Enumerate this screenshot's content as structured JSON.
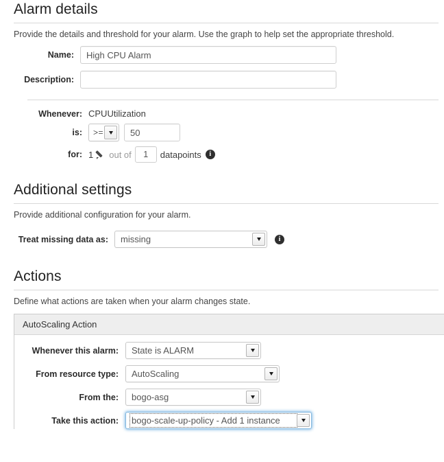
{
  "alarm_details": {
    "title": "Alarm details",
    "description": "Provide the details and threshold for your alarm. Use the graph to help set the appropriate threshold.",
    "name_label": "Name:",
    "name_value": "High CPU Alarm",
    "description_label": "Description:",
    "description_value": "",
    "whenever_label": "Whenever:",
    "metric_name": "CPUUtilization",
    "is_label": "is:",
    "operator_value": ">=",
    "threshold_value": "50",
    "for_label": "for:",
    "for_count": "1",
    "out_of_text": "out of",
    "datapoints_count": "1",
    "datapoints_text": "datapoints",
    "pencil_icon": "pencil-icon",
    "info_icon": "info-icon"
  },
  "additional_settings": {
    "title": "Additional settings",
    "description": "Provide additional configuration for your alarm.",
    "missing_data_label": "Treat missing data as:",
    "missing_data_value": "missing",
    "info_icon": "info-icon"
  },
  "actions": {
    "title": "Actions",
    "description": "Define what actions are taken when your alarm changes state.",
    "panel_title": "AutoScaling Action",
    "fields": [
      {
        "label": "Whenever this alarm:",
        "value": "State is ALARM"
      },
      {
        "label": "From resource type:",
        "value": "AutoScaling"
      },
      {
        "label": "From the:",
        "value": "bogo-asg"
      },
      {
        "label": "Take this action:",
        "value": "bogo-scale-up-policy - Add 1 instance"
      }
    ]
  },
  "icons": {
    "caret_down": "chevron-down-icon"
  },
  "colors": {
    "focus_blue": "#86b9e0",
    "panel_header_bg": "#eeeeee",
    "rule": "#d8d8d8"
  }
}
